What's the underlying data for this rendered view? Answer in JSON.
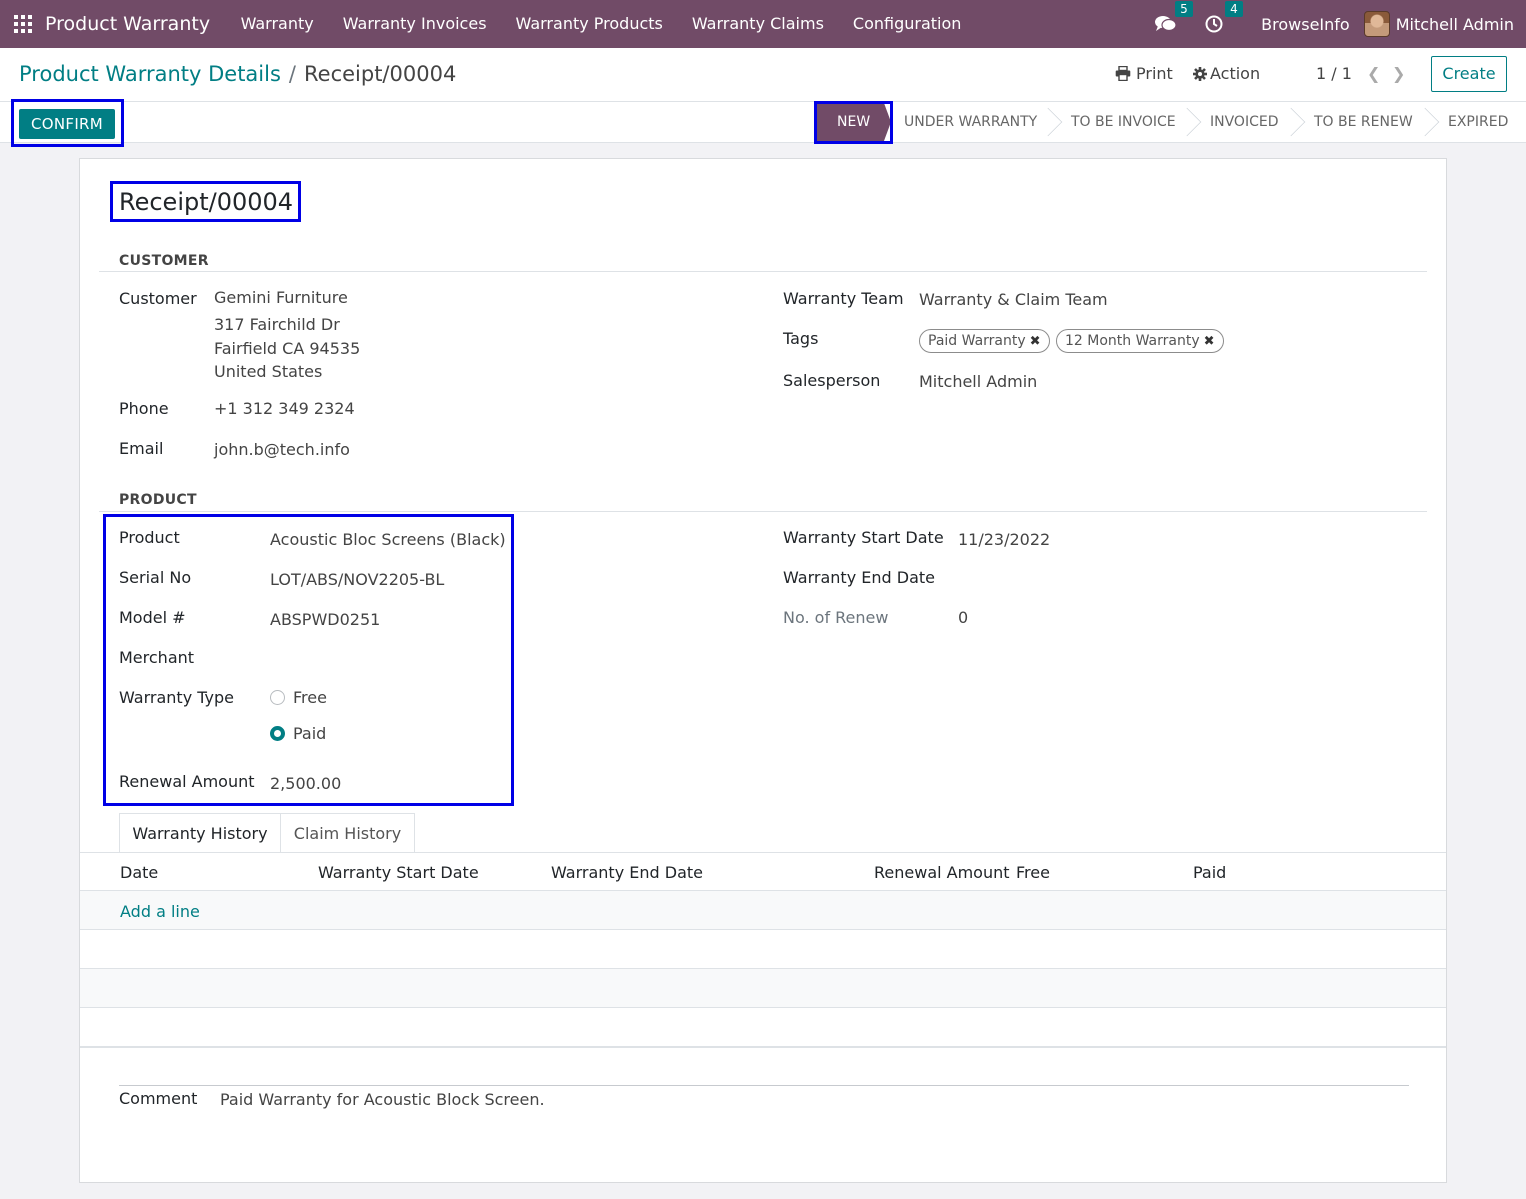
{
  "navbar": {
    "app_name": "Product Warranty",
    "menu": [
      "Warranty",
      "Warranty Invoices",
      "Warranty Products",
      "Warranty Claims",
      "Configuration"
    ],
    "messages_count": "5",
    "activities_count": "4",
    "company": "BrowseInfo",
    "user": "Mitchell Admin",
    "bg_color": "#714b67"
  },
  "control_panel": {
    "breadcrumb_parent": "Product Warranty Details",
    "breadcrumb_sep": "/",
    "breadcrumb_current": "Receipt/00004",
    "print_label": "Print",
    "action_label": "Action",
    "pager": "1 / 1",
    "create_label": "Create"
  },
  "statusbar": {
    "confirm_label": "CONFIRM",
    "stages": [
      "NEW",
      "UNDER WARRANTY",
      "TO BE INVOICE",
      "INVOICED",
      "TO BE RENEW",
      "EXPIRED"
    ],
    "active_stage": "NEW"
  },
  "record": {
    "title": "Receipt/00004",
    "customer_section": "CUSTOMER",
    "customer_label": "Customer",
    "customer_name": "Gemini Furniture",
    "customer_address": [
      "317 Fairchild Dr",
      "Fairfield CA 94535",
      "United States"
    ],
    "phone_label": "Phone",
    "phone": "+1 312 349 2324",
    "email_label": "Email",
    "email": "john.b@tech.info",
    "team_label": "Warranty Team",
    "team": "Warranty & Claim Team",
    "tags_label": "Tags",
    "tags": [
      "Paid Warranty",
      "12 Month Warranty"
    ],
    "salesperson_label": "Salesperson",
    "salesperson": "Mitchell Admin",
    "product_section": "PRODUCT",
    "product_label": "Product",
    "product": "Acoustic Bloc Screens (Black)",
    "serial_label": "Serial No",
    "serial": "LOT/ABS/NOV2205-BL",
    "model_label": "Model #",
    "model": "ABSPWD0251",
    "merchant_label": "Merchant",
    "warranty_type_label": "Warranty Type",
    "warranty_type_options": [
      "Free",
      "Paid"
    ],
    "warranty_type_selected": "Paid",
    "renewal_amount_label": "Renewal Amount",
    "renewal_amount": "2,500.00",
    "start_date_label": "Warranty Start Date",
    "start_date": "11/23/2022",
    "end_date_label": "Warranty End Date",
    "renew_count_label": "No. of Renew",
    "renew_count": "0"
  },
  "tabs": [
    "Warranty History",
    "Claim History"
  ],
  "history_table": {
    "columns": [
      "Date",
      "Warranty Start Date",
      "Warranty End Date",
      "Renewal Amount",
      "Free",
      "Paid"
    ],
    "add_line": "Add a line"
  },
  "comment": {
    "label": "Comment",
    "value": "Paid Warranty for Acoustic Block Screen."
  },
  "accent_color": "#017e84"
}
